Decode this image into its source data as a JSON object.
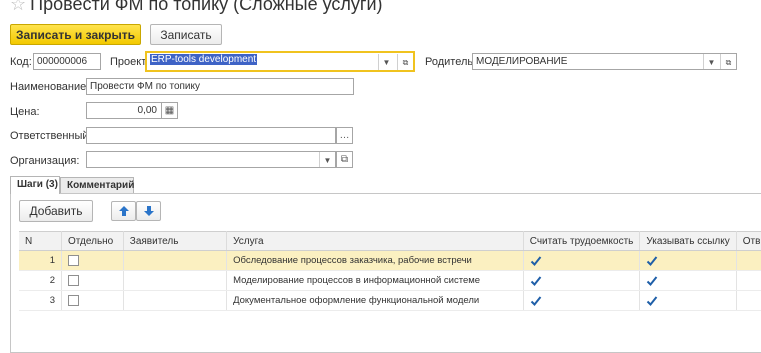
{
  "window": {
    "title": "Провести ФМ по топику (Сложные услуги)",
    "star": "☆"
  },
  "toolbar": {
    "save_close_label": "Записать и закрыть",
    "save_label": "Записать"
  },
  "fields": {
    "code_label": "Код:",
    "code_value": "000000006",
    "project_label": "Проект:",
    "project_value": "ERP-tools development",
    "parent_label": "Родитель:",
    "parent_value": "МОДЕЛИРОВАНИЕ",
    "name_label": "Наименование:",
    "name_value": "Провести ФМ по топику",
    "price_label": "Цена:",
    "price_value": "0,00",
    "responsible_label": "Ответственный:",
    "responsible_value": "",
    "org_label": "Организация:",
    "org_value": ""
  },
  "tabs": [
    {
      "label": "Шаги (3)",
      "active": true
    },
    {
      "label": "Комментарий",
      "active": false
    }
  ],
  "steps_toolbar": {
    "add_label": "Добавить",
    "more_label": "..."
  },
  "grid": {
    "columns": [
      "N",
      "Отдельно",
      "Заявитель",
      "Услуга",
      "Считать трудоемкость",
      "Указывать ссылку",
      "Отв"
    ],
    "rows": [
      {
        "n": "1",
        "service": "Обследование процессов заказчика, рабочие встречи",
        "separate": false,
        "count_labor": true,
        "specify_link": true
      },
      {
        "n": "2",
        "service": "Моделирование процессов в информационной системе",
        "separate": false,
        "count_labor": true,
        "specify_link": true
      },
      {
        "n": "3",
        "service": "Документальное оформление функциональной модели",
        "separate": false,
        "count_labor": true,
        "specify_link": true
      }
    ]
  },
  "colors": {
    "accent_yellow": "#f3c900",
    "selection_blue": "#3e63c6",
    "active_row": "#fbf0c1",
    "check_blue": "#1f5fa8"
  }
}
